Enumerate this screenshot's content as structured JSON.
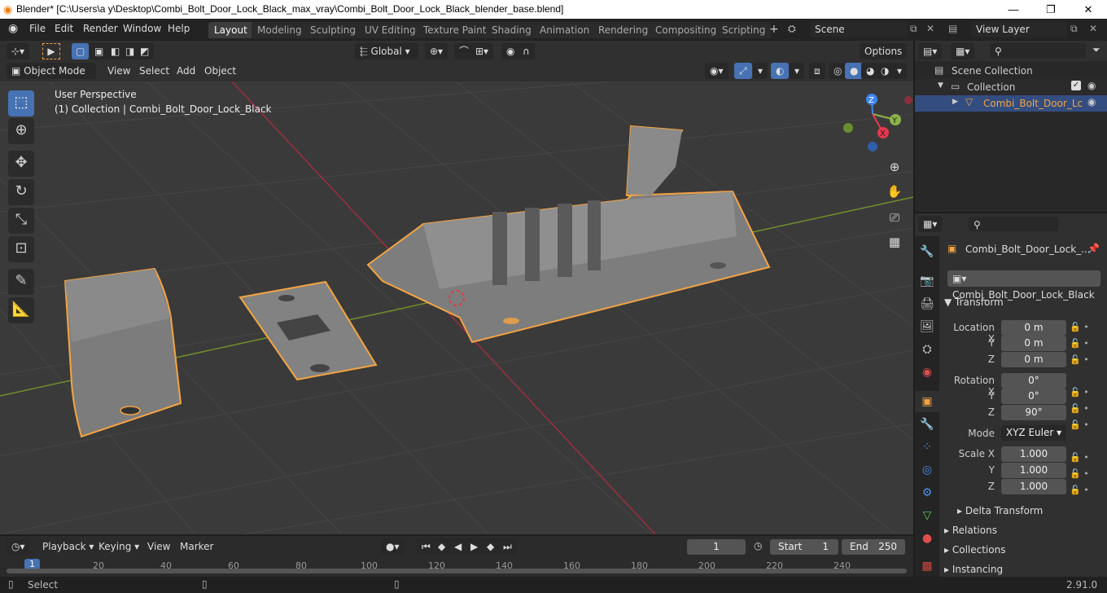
{
  "window": {
    "title": "Blender* [C:\\Users\\a y\\Desktop\\Combi_Bolt_Door_Lock_Black_max_vray\\Combi_Bolt_Door_Lock_Black_blender_base.blend]"
  },
  "menu": [
    "File",
    "Edit",
    "Render",
    "Window",
    "Help"
  ],
  "workspaces": [
    "Layout",
    "Modeling",
    "Sculpting",
    "UV Editing",
    "Texture Paint",
    "Shading",
    "Animation",
    "Rendering",
    "Compositing",
    "Scripting"
  ],
  "scene": "Scene",
  "view_layer": "View Layer",
  "header": {
    "transform": "Global",
    "options": "Options"
  },
  "viewport_menu": {
    "mode": "Object Mode",
    "view": "View",
    "select": "Select",
    "add": "Add",
    "object": "Object"
  },
  "overlay": {
    "line1": "User Perspective",
    "line2": "(1) Collection | Combi_Bolt_Door_Lock_Black"
  },
  "gizmo": {
    "x": "X",
    "y": "Y",
    "z": "Z"
  },
  "outliner": {
    "scene_collection": "Scene Collection",
    "collection": "Collection",
    "object": "Combi_Bolt_Door_Lc"
  },
  "properties": {
    "object_name": "Combi_Bolt_Door_Lock_...",
    "data_name": "Combi_Bolt_Door_Lock_Black",
    "transform": "Transform",
    "location_x_label": "Location X",
    "location_x": "0 m",
    "y_label": "Y",
    "location_y": "0 m",
    "z_label": "Z",
    "location_z": "0 m",
    "rotation_x_label": "Rotation X",
    "rotation_x": "0°",
    "rotation_y": "0°",
    "rotation_z": "90°",
    "mode_label": "Mode",
    "mode": "XYZ Euler",
    "scale_x_label": "Scale X",
    "scale_x": "1.000",
    "scale_y": "1.000",
    "scale_z": "1.000",
    "delta": "Delta Transform",
    "relations": "Relations",
    "collections": "Collections",
    "instancing": "Instancing"
  },
  "timeline": {
    "playback": "Playback",
    "keying": "Keying",
    "view": "View",
    "marker": "Marker",
    "frame": "1",
    "start_label": "Start",
    "start": "1",
    "end_label": "End",
    "end": "250",
    "current": "1",
    "ruler": [
      "20",
      "40",
      "60",
      "80",
      "100",
      "120",
      "140",
      "160",
      "180",
      "200",
      "220",
      "240"
    ]
  },
  "status": {
    "left": "Select",
    "version": "2.91.0"
  },
  "colors": {
    "accent": "#4772b3",
    "selection": "#f5a442",
    "x_axis": "#e8384f",
    "y_axis": "#8bb346",
    "z_axis": "#3e85ef"
  }
}
